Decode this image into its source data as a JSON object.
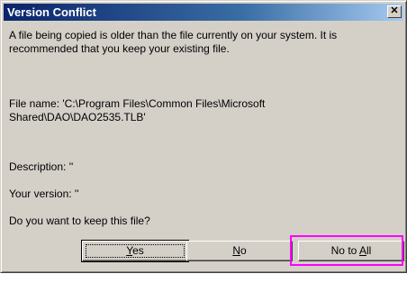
{
  "dialog": {
    "title": "Version Conflict",
    "close_glyph": "✕",
    "message": "A file being copied is older than the file currently on your system.  It is recommended that you keep your existing file.",
    "filename_line": "File name:   'C:\\Program Files\\Common Files\\Microsoft Shared\\DAO\\DAO2535.TLB'",
    "description_line": "Description:  ''",
    "your_version_line": "Your version:  ''",
    "question": "Do you want to keep this file?"
  },
  "buttons": {
    "yes": {
      "mnemonic": "Y",
      "rest": "es"
    },
    "no": {
      "mnemonic": "N",
      "rest": "o"
    },
    "no_to_all": {
      "prefix": "No to ",
      "mnemonic": "A",
      "rest": "ll"
    }
  },
  "colors": {
    "title_start": "#0a246a",
    "title_end": "#a6caf0",
    "face": "#d4d0c8",
    "highlight_annotation": "#ff00ff"
  }
}
